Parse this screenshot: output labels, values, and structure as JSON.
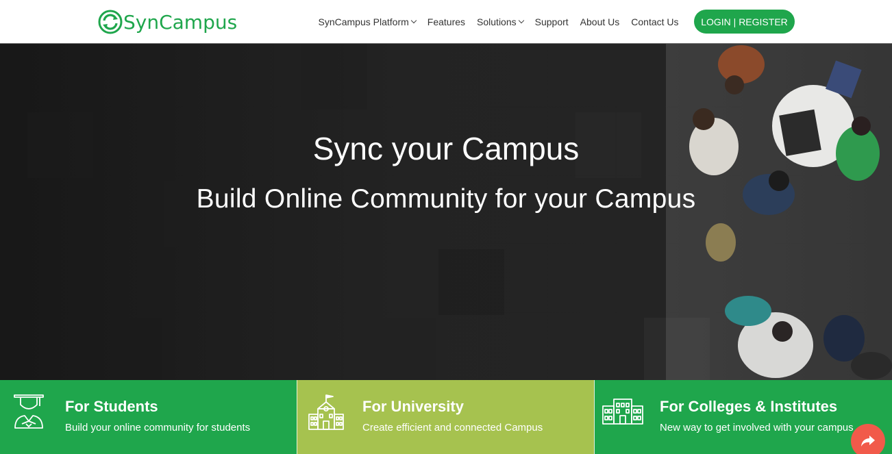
{
  "brand": {
    "name": "SynCampus",
    "logo_icon": "sync-circle-icon",
    "accent": "#1fa64c"
  },
  "nav": {
    "items": [
      {
        "label": "SynCampus Platform",
        "dropdown": true
      },
      {
        "label": "Features",
        "dropdown": false
      },
      {
        "label": "Solutions",
        "dropdown": true
      },
      {
        "label": "Support",
        "dropdown": false
      },
      {
        "label": "About Us",
        "dropdown": false
      },
      {
        "label": "Contact Us",
        "dropdown": false
      }
    ],
    "login_label": "LOGIN | REGISTER"
  },
  "hero": {
    "title": "Sync your Campus",
    "subtitle": "Build Online Community for your Campus"
  },
  "cards": [
    {
      "title": "For Students",
      "desc": "Build your online community for students",
      "icon": "graduate-icon",
      "color": "#1fa64c"
    },
    {
      "title": "For University",
      "desc": "Create efficient and connected Campus",
      "icon": "university-building-icon",
      "color": "#a6c24f"
    },
    {
      "title": "For Colleges & Institutes",
      "desc": "New way to get involved with your campus",
      "icon": "college-building-icon",
      "color": "#1fa64c"
    }
  ],
  "share": {
    "icon": "share-arrow-icon",
    "color": "#f15a4a"
  }
}
